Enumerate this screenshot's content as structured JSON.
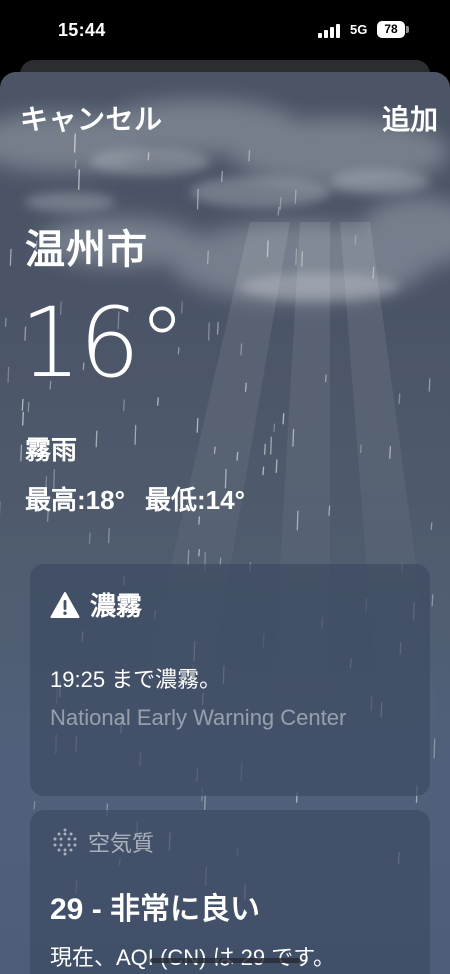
{
  "status_bar": {
    "time": "15:44",
    "network": "5G",
    "battery": "78"
  },
  "header": {
    "cancel_label": "キャンセル",
    "add_label": "追加"
  },
  "weather": {
    "city": "温州市",
    "temperature": "16°",
    "condition": "霧雨",
    "high": "最高:18°",
    "low": "最低:14°"
  },
  "warning_card": {
    "icon": "warning-triangle-icon",
    "title": "濃霧",
    "message": "19:25 まで濃霧。",
    "source": "National Early Warning Center"
  },
  "aqi_card": {
    "icon": "air-quality-dots-icon",
    "label": "空気質",
    "value": "29 - 非常に良い",
    "description": "現在、AQI (CN) は 29 です。"
  },
  "colors": {
    "background_top": "#4b5565",
    "background_bottom": "#4e5e79",
    "card": "#3d4b63",
    "muted_text": "#a4aab5"
  }
}
